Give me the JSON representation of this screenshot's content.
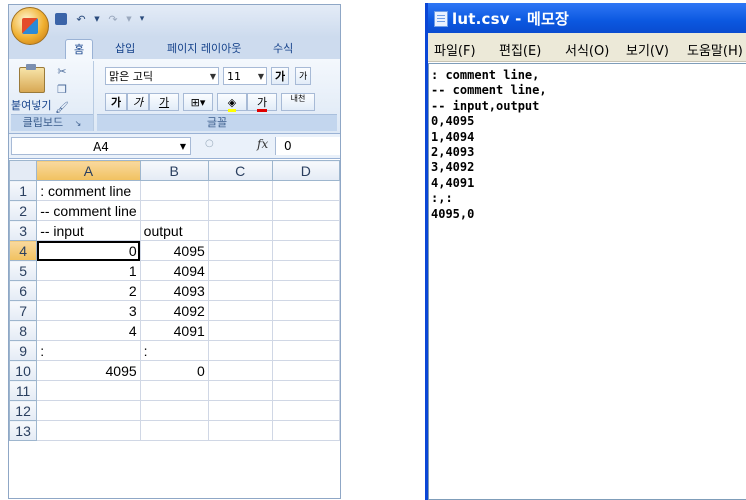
{
  "excel": {
    "tabs": [
      "홈",
      "삽입",
      "페이지 레이아웃",
      "수식"
    ],
    "clipboard": {
      "paste_label": "붙여넣기",
      "group_label": "클립보드"
    },
    "font": {
      "name": "맑은 고딕",
      "size": "11",
      "grow": "가",
      "shrink": "가",
      "bold": "가",
      "italic": "가",
      "underline": "가",
      "color_btn": "가",
      "phonetic": "내천",
      "group_label": "글꼴"
    },
    "name_box": "A4",
    "fx_label": "fx",
    "formula_value": "0",
    "columns": [
      "A",
      "B",
      "C",
      "D"
    ],
    "rows": [
      {
        "num": "1",
        "a": ": comment line",
        "b": "",
        "a_num": false,
        "b_num": false
      },
      {
        "num": "2",
        "a": "-- comment line",
        "b": "",
        "a_num": false,
        "b_num": false
      },
      {
        "num": "3",
        "a": "-- input",
        "b": "output",
        "a_num": false,
        "b_num": false
      },
      {
        "num": "4",
        "a": "0",
        "b": "4095",
        "a_num": true,
        "b_num": true
      },
      {
        "num": "5",
        "a": "1",
        "b": "4094",
        "a_num": true,
        "b_num": true
      },
      {
        "num": "6",
        "a": "2",
        "b": "4093",
        "a_num": true,
        "b_num": true
      },
      {
        "num": "7",
        "a": "3",
        "b": "4092",
        "a_num": true,
        "b_num": true
      },
      {
        "num": "8",
        "a": "4",
        "b": "4091",
        "a_num": true,
        "b_num": true
      },
      {
        "num": "9",
        "a": ":",
        "b": ":",
        "a_num": false,
        "b_num": false
      },
      {
        "num": "10",
        "a": "4095",
        "b": "0",
        "a_num": true,
        "b_num": true
      },
      {
        "num": "11",
        "a": "",
        "b": "",
        "a_num": false,
        "b_num": false
      },
      {
        "num": "12",
        "a": "",
        "b": "",
        "a_num": false,
        "b_num": false
      },
      {
        "num": "13",
        "a": "",
        "b": "",
        "a_num": false,
        "b_num": false
      }
    ]
  },
  "notepad": {
    "title": "lut.csv - 메모장",
    "menu": [
      "파일(F)",
      "편집(E)",
      "서식(O)",
      "보기(V)",
      "도움말(H)"
    ],
    "content": ": comment line,\n-- comment line,\n-- input,output\n0,4095\n1,4094\n2,4093\n3,4092\n4,4091\n:,:\n4095,0"
  }
}
